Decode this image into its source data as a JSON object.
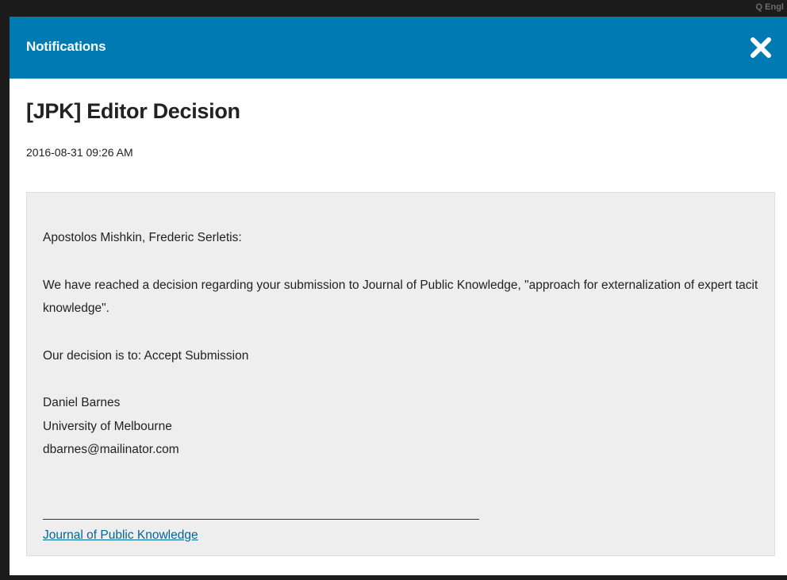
{
  "backdrop": {
    "corner_text": "Q Engl"
  },
  "modal": {
    "title": "Notifications",
    "close_icon": "close-icon"
  },
  "notification": {
    "title": "[JPK] Editor Decision",
    "date": "2016-08-31 09:26 AM",
    "greeting": "Apostolos Mishkin, Frederic Serletis:",
    "body": "We have reached a decision regarding your submission to Journal of Public Knowledge, \"approach for externalization of expert tacit knowledge\".",
    "decision": "Our decision is to: Accept Submission",
    "signature": {
      "name": "Daniel Barnes",
      "affiliation": "University of Melbourne",
      "email": "dbarnes@mailinator.com"
    },
    "footer_link": "Journal of Public Knowledge"
  },
  "colors": {
    "header": "#007ab2",
    "link": "#006798",
    "content_bg": "#eeeeee"
  }
}
